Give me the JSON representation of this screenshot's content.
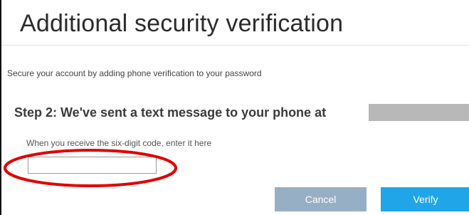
{
  "page": {
    "title": "Additional security verification",
    "subtitle": "Secure your account by adding phone verification to your password"
  },
  "step": {
    "heading": "Step 2: We've sent a text message to your phone at",
    "phone_redacted": true
  },
  "code_entry": {
    "hint": "When you receive the six-digit code, enter it here",
    "value": "",
    "placeholder": ""
  },
  "actions": {
    "cancel_label": "Cancel",
    "verify_label": "Verify"
  },
  "annotation": {
    "shape": "ellipse",
    "color": "#e00000"
  },
  "colors": {
    "cancel_button": "#97afc4",
    "verify_button": "#1fa5e8",
    "redaction": "#b8b8b8"
  }
}
